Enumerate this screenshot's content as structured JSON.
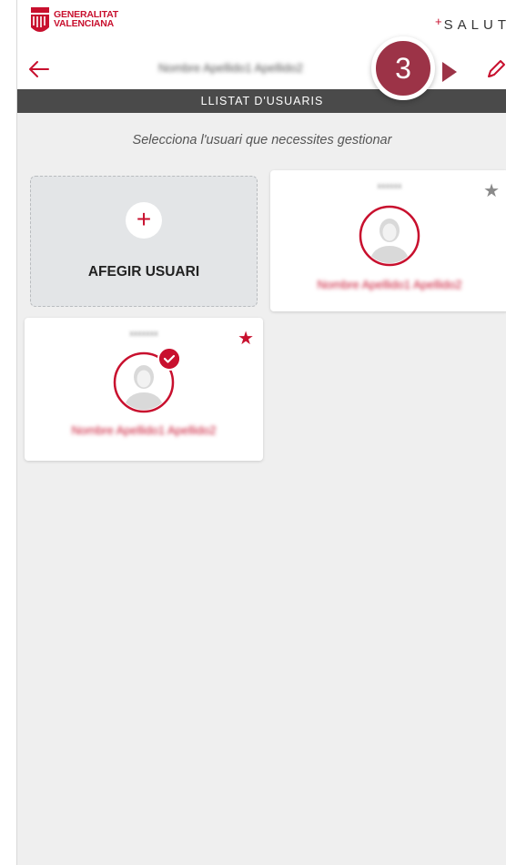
{
  "brand": {
    "org_line1": "GENERALITAT",
    "org_line2": "VALENCIANA",
    "salut_plus": "+",
    "salut_text": "SALUT"
  },
  "header": {
    "user_name": "Nombre Apellido1 Apellido2",
    "back_icon": "arrow-left-icon",
    "edit_icon": "pencil-icon"
  },
  "title_bar": {
    "label": "LLISTAT D'USUARIS"
  },
  "instruction": "Selecciona l'usuari que necessites gestionar",
  "add_user": {
    "plus": "+",
    "label": "AFEGIR USUARI"
  },
  "users": [
    {
      "tag": "xxxxxx",
      "name": "Nombre Apellido1 Apellido2",
      "favorite": false,
      "selected": false
    },
    {
      "tag": "xxxxxxx",
      "name": "Nombre Apellido1 Apellido2",
      "favorite": true,
      "selected": true
    }
  ],
  "step_annotation": {
    "number": "3"
  },
  "colors": {
    "accent": "#c8102e",
    "title_bar": "#4a4a4a",
    "background": "#efefef",
    "annotation": "#9c3347"
  }
}
